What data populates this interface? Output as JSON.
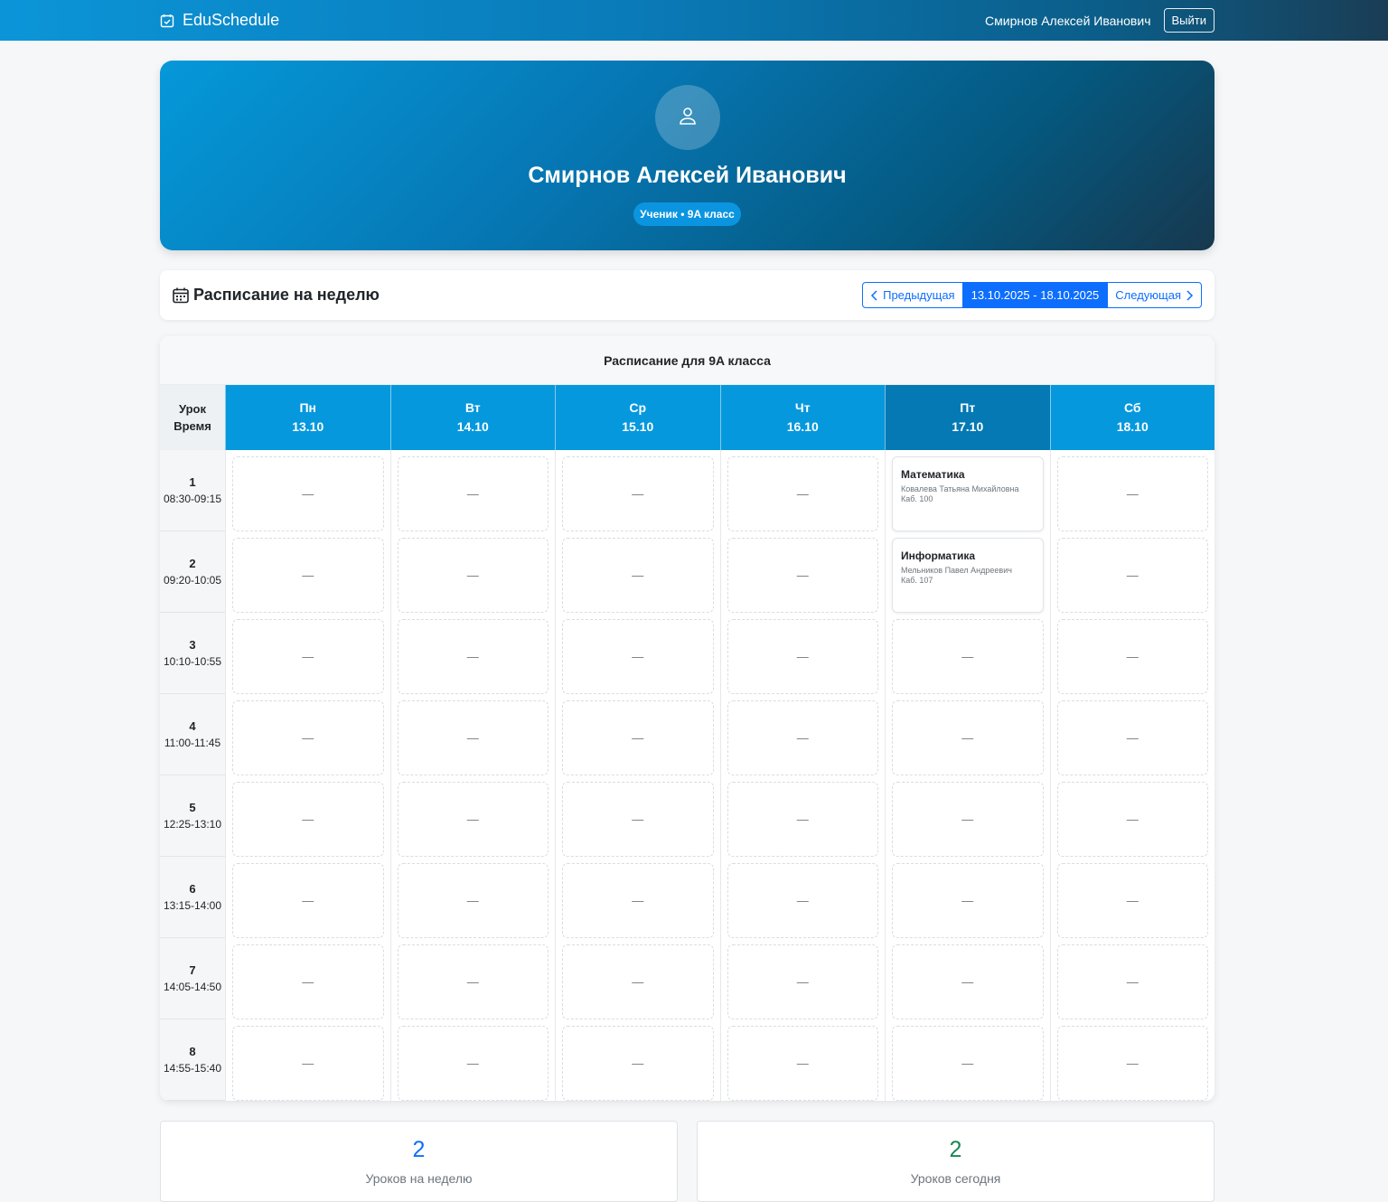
{
  "app": {
    "brand": "EduSchedule",
    "user_name": "Смирнов Алексей Иванович",
    "logout_label": "Выйти"
  },
  "profile": {
    "name": "Смирнов Алексей Иванович",
    "role_badge": "Ученик • 9A класс"
  },
  "week": {
    "title": "Расписание на неделю",
    "prev_label": "Предыдущая",
    "range": "13.10.2025 - 18.10.2025",
    "next_label": "Следующая"
  },
  "schedule": {
    "title": "Расписание для 9A класса",
    "corner_line1": "Урок",
    "corner_line2": "Время",
    "empty_mark": "—",
    "days": [
      {
        "name": "Пн",
        "date": "13.10"
      },
      {
        "name": "Вт",
        "date": "14.10"
      },
      {
        "name": "Ср",
        "date": "15.10"
      },
      {
        "name": "Чт",
        "date": "16.10"
      },
      {
        "name": "Пт",
        "date": "17.10",
        "today": true
      },
      {
        "name": "Сб",
        "date": "18.10"
      }
    ],
    "periods": [
      {
        "num": "1",
        "time": "08:30-09:15"
      },
      {
        "num": "2",
        "time": "09:20-10:05"
      },
      {
        "num": "3",
        "time": "10:10-10:55"
      },
      {
        "num": "4",
        "time": "11:00-11:45"
      },
      {
        "num": "5",
        "time": "12:25-13:10"
      },
      {
        "num": "6",
        "time": "13:15-14:00"
      },
      {
        "num": "7",
        "time": "14:05-14:50"
      },
      {
        "num": "8",
        "time": "14:55-15:40"
      }
    ],
    "lessons": [
      {
        "day": 4,
        "period": 0,
        "subject": "Математика",
        "teacher": "Ковалева Татьяна Михайловна",
        "room": "Каб. 100"
      },
      {
        "day": 4,
        "period": 1,
        "subject": "Информатика",
        "teacher": "Мельников Павел Андреевич",
        "room": "Каб. 107"
      }
    ]
  },
  "stats": {
    "week_count": "2",
    "week_label": "Уроков на неделю",
    "today_count": "2",
    "today_label": "Уроков сегодня"
  },
  "colors": {
    "primary": "#0d6efd",
    "header_day": "#0598dd",
    "header_today": "#0479b4",
    "success": "#198754"
  }
}
